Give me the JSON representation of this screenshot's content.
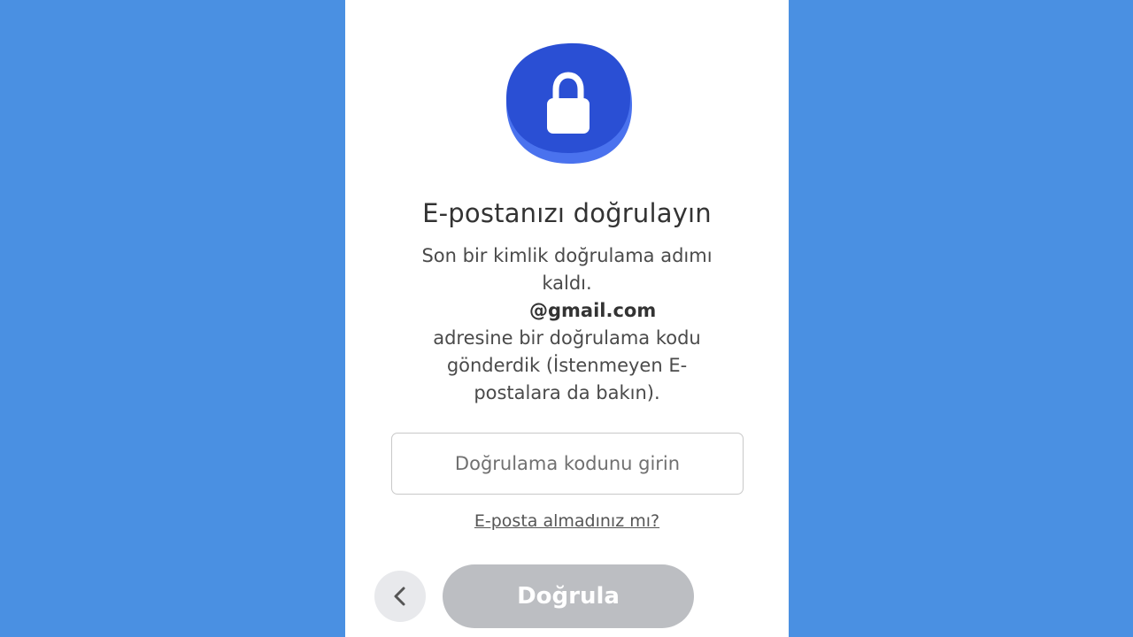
{
  "colors": {
    "background": "#4a90e2",
    "panel": "#ffffff",
    "badge_primary": "#2a4fd4",
    "badge_shadow": "#4a72ee",
    "button_disabled": "#bcbec2",
    "back_button_bg": "#e8e9ec"
  },
  "header": {
    "icon": "lock-icon",
    "title": "E-postanızı doğrulayın"
  },
  "description": {
    "line1": "Son bir kimlik doğrulama adımı kaldı.",
    "email": "@gmail.com",
    "line2": "adresine bir doğrulama kodu gönderdik (İstenmeyen E-postalara da bakın)."
  },
  "form": {
    "code_placeholder": "Doğrulama kodunu girin",
    "code_value": "",
    "resend_link": "E-posta almadınız mı?"
  },
  "actions": {
    "back_icon": "chevron-left-icon",
    "verify_label": "Doğrula"
  }
}
